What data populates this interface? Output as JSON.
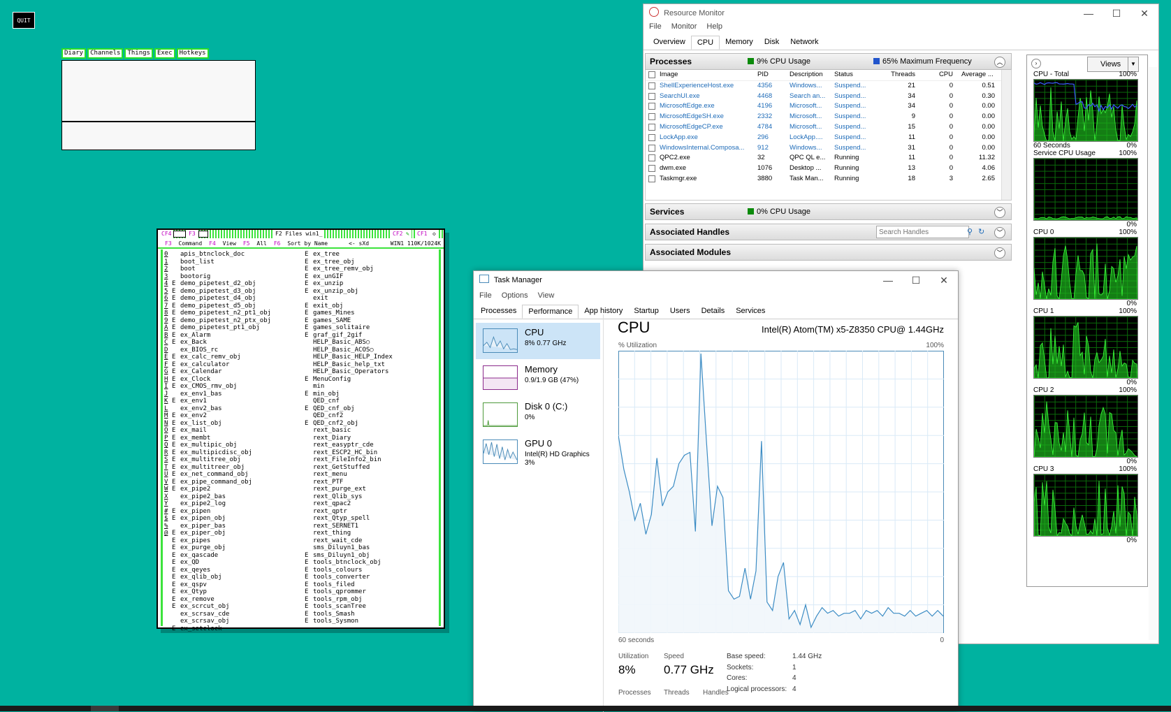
{
  "ql": {
    "quit_label": "QUIT",
    "menu": [
      "Diary",
      "Channels",
      "Things",
      "Exec",
      "Hotkeys"
    ]
  },
  "files": {
    "title": "F2 Files win1_",
    "tb_left": [
      "CF4",
      "F3"
    ],
    "tb_right": [
      "CF2",
      "CF1"
    ],
    "menu": {
      "f3": "F3",
      "command": "Command",
      "f4": "F4",
      "view": "View",
      "f5": "F5",
      "all": "All",
      "f6": "F6",
      "sort": "Sort by Name",
      "path": "<- sXd",
      "device": "WIN1 110K/1024K"
    },
    "col1": [
      [
        "0",
        "",
        "apis_btnclock_doc"
      ],
      [
        "1",
        "",
        "boot_list"
      ],
      [
        "2",
        "",
        "boot"
      ],
      [
        "3",
        "",
        "bootorig"
      ],
      [
        "4",
        "E",
        "demo_pipetest_d2_obj"
      ],
      [
        "5",
        "E",
        "demo_pipetest_d3_obj"
      ],
      [
        "6",
        "E",
        "demo_pipetest_d4_obj"
      ],
      [
        "7",
        "E",
        "demo_pipetest_d5_obj"
      ],
      [
        "8",
        "E",
        "demo_pipetest_n2_pt1_obj"
      ],
      [
        "9",
        "E",
        "demo_pipetest_n2_ptx_obj"
      ],
      [
        "A",
        "E",
        "demo_pipetest_pt1_obj"
      ],
      [
        "B",
        "E",
        "ex_Alarm"
      ],
      [
        "C",
        "E",
        "ex_Back"
      ],
      [
        "D",
        "",
        "ex_BIOS_rc"
      ],
      [
        "E",
        "E",
        "ex_calc_remv_obj"
      ],
      [
        "F",
        "E",
        "ex_calculator"
      ],
      [
        "G",
        "E",
        "ex_Calendar"
      ],
      [
        "H",
        "E",
        "ex_Clock"
      ],
      [
        "I",
        "E",
        "ex_CMOS_rmv_obj"
      ],
      [
        "J",
        "",
        "ex_env1_bas"
      ],
      [
        "K",
        "E",
        "ex_env1"
      ],
      [
        "L",
        "",
        "ex_env2_bas"
      ],
      [
        "M",
        "E",
        "ex_env2"
      ],
      [
        "N",
        "E",
        "ex_list_obj"
      ],
      [
        "O",
        "E",
        "ex_mail"
      ],
      [
        "P",
        "E",
        "ex_membt"
      ],
      [
        "Q",
        "E",
        "ex_multipic_obj"
      ],
      [
        "R",
        "E",
        "ex_multipicdisc_obj"
      ],
      [
        "S",
        "E",
        "ex_multitree_obj"
      ],
      [
        "T",
        "E",
        "ex_multitreer_obj"
      ],
      [
        "U",
        "E",
        "ex_net_command_obj"
      ],
      [
        "V",
        "E",
        "ex_pipe_command_obj"
      ],
      [
        "W",
        "E",
        "ex_pipe2"
      ],
      [
        "X",
        "",
        "ex_pipe2_bas"
      ],
      [
        "Y",
        "",
        "ex_pipe2_log"
      ],
      [
        "#",
        "E",
        "ex_pipen"
      ],
      [
        "$",
        "E",
        "ex_pipen_obj"
      ],
      [
        "%",
        "",
        "ex_piper_bas"
      ],
      [
        "@",
        "E",
        "ex_piper_obj"
      ],
      [
        "",
        "E",
        "ex_pipes"
      ],
      [
        "",
        "E",
        "ex_purge_obj"
      ],
      [
        "",
        "E",
        "ex_qascade"
      ],
      [
        "",
        "E",
        "ex_QD"
      ],
      [
        "",
        "E",
        "ex_qeyes"
      ],
      [
        "",
        "E",
        "ex_qlib_obj"
      ],
      [
        "",
        "E",
        "ex_qspv"
      ],
      [
        "",
        "E",
        "ex_Qtyp"
      ],
      [
        "",
        "E",
        "ex_remove"
      ],
      [
        "",
        "E",
        "ex_scrcut_obj"
      ],
      [
        "",
        "",
        "ex_scrsav_cde"
      ],
      [
        "",
        "",
        "ex_scrsav_obj"
      ],
      [
        "",
        "E",
        "ex_setclock"
      ]
    ],
    "col2": [
      [
        "E",
        "ex_tree"
      ],
      [
        "E",
        "ex_tree_obj"
      ],
      [
        "E",
        "ex_tree_remv_obj"
      ],
      [
        "E",
        "ex_unGIF"
      ],
      [
        "E",
        "ex_unzip"
      ],
      [
        "E",
        "ex_unzip_obj"
      ],
      [
        "",
        "exit"
      ],
      [
        "E",
        "exit_obj"
      ],
      [
        "E",
        "games_Mines"
      ],
      [
        "E",
        "games_SAME"
      ],
      [
        "E",
        "games_solitaire"
      ],
      [
        "E",
        "graf_gif_2gif"
      ],
      [
        "",
        "HELP_Basic_ABS○"
      ],
      [
        "",
        "HELP_Basic_ACOS○"
      ],
      [
        "",
        "HELP_Basic_HELP_Index"
      ],
      [
        "",
        "HELP_Basic_help_txt"
      ],
      [
        "",
        "HELP_Basic_Operators"
      ],
      [
        "E",
        "MenuConfig"
      ],
      [
        "",
        "min"
      ],
      [
        "E",
        "min_obj"
      ],
      [
        "",
        "QED_cnf"
      ],
      [
        "E",
        "QED_cnf_obj"
      ],
      [
        "",
        "QED_cnf2"
      ],
      [
        "E",
        "QED_cnf2_obj"
      ],
      [
        "",
        "rext_basic"
      ],
      [
        "",
        "rext_Diary"
      ],
      [
        "",
        "rext_easyptr_cde"
      ],
      [
        "",
        "rext_ESCP2_HC_bin"
      ],
      [
        "",
        "rext_FileInfo2_bin"
      ],
      [
        "",
        "rext_GetStuffed"
      ],
      [
        "",
        "rext_menu"
      ],
      [
        "",
        "rext_PTF"
      ],
      [
        "",
        "rext_purge_ext"
      ],
      [
        "",
        "rext_Qlib_sys"
      ],
      [
        "",
        "rext_qpac2"
      ],
      [
        "",
        "rext_qptr"
      ],
      [
        "",
        "rext_Qtyp_spell"
      ],
      [
        "",
        "rext_SERNET1"
      ],
      [
        "",
        "rext_thing"
      ],
      [
        "",
        "rext_wait_cde"
      ],
      [
        "",
        "sms_Diluyn1_bas"
      ],
      [
        "E",
        "sms_Diluyn1_obj"
      ],
      [
        "E",
        "tools_btnclock_obj"
      ],
      [
        "E",
        "tools_colours"
      ],
      [
        "E",
        "tools_converter"
      ],
      [
        "E",
        "tools_filed"
      ],
      [
        "E",
        "tools_qprommer"
      ],
      [
        "E",
        "tools_rpm_obj"
      ],
      [
        "E",
        "tools_scanTree"
      ],
      [
        "E",
        "tools_Smash"
      ],
      [
        "E",
        "tools_Sysmon"
      ]
    ]
  },
  "resmon": {
    "title": "Resource Monitor",
    "menu": [
      "File",
      "Monitor",
      "Help"
    ],
    "tabs": [
      "Overview",
      "CPU",
      "Memory",
      "Disk",
      "Network"
    ],
    "processes": {
      "label": "Processes",
      "cpu_usage": "9% CPU Usage",
      "max_freq": "65% Maximum Frequency",
      "headers": [
        "Image",
        "PID",
        "Description",
        "Status",
        "Threads",
        "CPU",
        "Average ..."
      ],
      "rows": [
        [
          "ShellExperienceHost.exe",
          "4356",
          "Windows...",
          "Suspend...",
          "21",
          "0",
          "0.51",
          true
        ],
        [
          "SearchUI.exe",
          "4468",
          "Search an...",
          "Suspend...",
          "34",
          "0",
          "0.30",
          true
        ],
        [
          "MicrosoftEdge.exe",
          "4196",
          "Microsoft...",
          "Suspend...",
          "34",
          "0",
          "0.00",
          true
        ],
        [
          "MicrosoftEdgeSH.exe",
          "2332",
          "Microsoft...",
          "Suspend...",
          "9",
          "0",
          "0.00",
          true
        ],
        [
          "MicrosoftEdgeCP.exe",
          "4784",
          "Microsoft...",
          "Suspend...",
          "15",
          "0",
          "0.00",
          true
        ],
        [
          "LockApp.exe",
          "296",
          "LockApp....",
          "Suspend...",
          "11",
          "0",
          "0.00",
          true
        ],
        [
          "WindowsInternal.Composa...",
          "912",
          "Windows...",
          "Suspend...",
          "31",
          "0",
          "0.00",
          true
        ],
        [
          "QPC2.exe",
          "32",
          "QPC QL e...",
          "Running",
          "11",
          "0",
          "11.32",
          false
        ],
        [
          "dwm.exe",
          "1076",
          "Desktop ...",
          "Running",
          "13",
          "0",
          "4.06",
          false
        ],
        [
          "Taskmgr.exe",
          "3880",
          "Task Man...",
          "Running",
          "18",
          "3",
          "2.65",
          false
        ]
      ]
    },
    "services": {
      "label": "Services",
      "cpu_usage": "0% CPU Usage"
    },
    "handles": {
      "label": "Associated Handles",
      "search_placeholder": "Search Handles"
    },
    "modules": {
      "label": "Associated Modules"
    },
    "views_label": "Views",
    "graphs": [
      {
        "title": "CPU - Total",
        "max": "100%",
        "foot_left": "60 Seconds",
        "foot_right": "0%"
      },
      {
        "title": "Service CPU Usage",
        "max": "100%",
        "foot_left": "",
        "foot_right": "0%"
      },
      {
        "title": "CPU 0",
        "max": "100%",
        "foot_left": "",
        "foot_right": "0%"
      },
      {
        "title": "CPU 1",
        "max": "100%",
        "foot_left": "",
        "foot_right": "0%"
      },
      {
        "title": "CPU 2",
        "max": "100%",
        "foot_left": "",
        "foot_right": "0%"
      },
      {
        "title": "CPU 3",
        "max": "100%",
        "foot_left": "",
        "foot_right": "0%"
      }
    ]
  },
  "taskmgr": {
    "title": "Task Manager",
    "menu": [
      "File",
      "Options",
      "View"
    ],
    "tabs": [
      "Processes",
      "Performance",
      "App history",
      "Startup",
      "Users",
      "Details",
      "Services"
    ],
    "side": [
      {
        "name": "CPU",
        "sub": "8% 0.77 GHz",
        "sub2": ""
      },
      {
        "name": "Memory",
        "sub": "0.9/1.9 GB (47%)",
        "sub2": ""
      },
      {
        "name": "Disk 0 (C:)",
        "sub": "0%",
        "sub2": ""
      },
      {
        "name": "GPU 0",
        "sub": "Intel(R) HD Graphics",
        "sub2": "3%"
      }
    ],
    "heading": "CPU",
    "cpu_model": "Intel(R) Atom(TM) x5-Z8350 CPU@ 1.44GHz",
    "util_label": "% Utilization",
    "max_label": "100%",
    "x_left": "60 seconds",
    "x_right": "0",
    "stats": {
      "utilization_label": "Utilization",
      "utilization": "8%",
      "speed_label": "Speed",
      "speed": "0.77 GHz",
      "processes_label": "Processes",
      "threads_label": "Threads",
      "handles_label": "Handles"
    },
    "specs": [
      [
        "Base speed:",
        "1.44 GHz"
      ],
      [
        "Sockets:",
        "1"
      ],
      [
        "Cores:",
        "4"
      ],
      [
        "Logical processors:",
        "4"
      ]
    ],
    "chart_data": {
      "type": "area",
      "ylim": [
        0,
        100
      ],
      "values": [
        70,
        58,
        50,
        40,
        46,
        35,
        42,
        62,
        45,
        50,
        52,
        60,
        63,
        64,
        36,
        99,
        68,
        38,
        52,
        48,
        15,
        12,
        13,
        23,
        12,
        22,
        68,
        11,
        8,
        20,
        25,
        5,
        8,
        3,
        10,
        2,
        6,
        9,
        7,
        8,
        6,
        7,
        7,
        8,
        5,
        8,
        7,
        8,
        6,
        9,
        7,
        7,
        6,
        8,
        6,
        7,
        8,
        6,
        8,
        6
      ]
    }
  }
}
